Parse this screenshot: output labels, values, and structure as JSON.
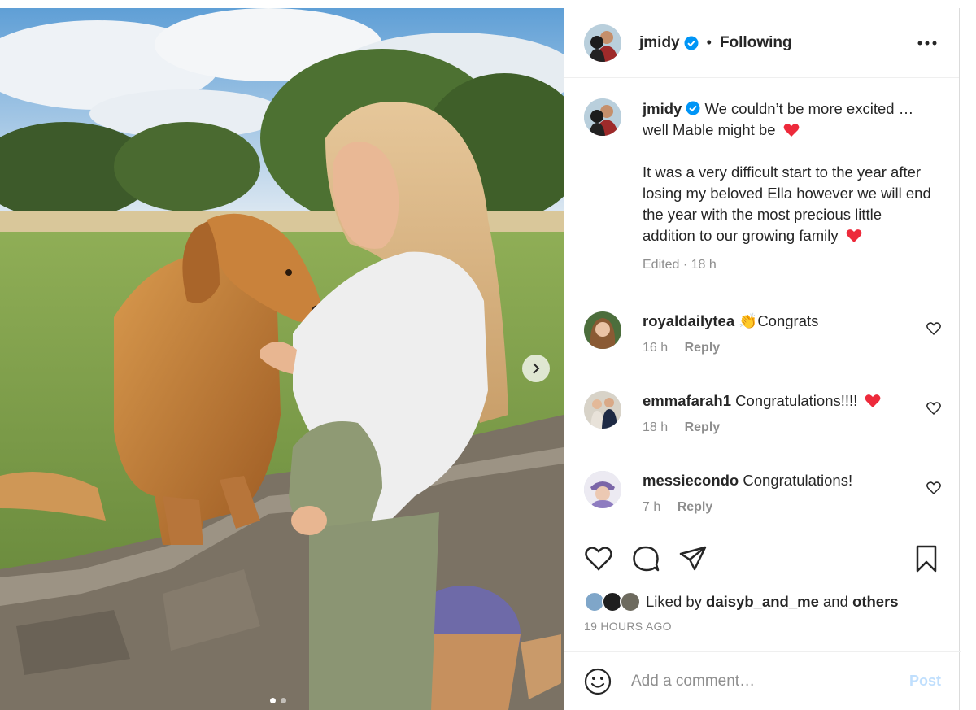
{
  "post": {
    "image_alt": "photo",
    "carousel_dot_count": 2,
    "carousel_active_index": 0
  },
  "header": {
    "username": "jmidy",
    "separator": "•",
    "follow_status": "Following",
    "more_icon": "more-options-icon"
  },
  "caption": {
    "username": "jmidy",
    "line1": "We couldn’t be more excited … well Mable might be",
    "line2": "It was a very difficult start to the year after losing my beloved Ella however we will end the year with the most precious little addition to our growing family",
    "edited": "Edited · 18 h"
  },
  "comments": [
    {
      "username": "royaldailytea",
      "emoji": "👏",
      "text": "Congrats",
      "time": "16 h",
      "reply": "Reply"
    },
    {
      "username": "emmafarah1",
      "text": "Congratulations!!!!",
      "time": "18 h",
      "reply": "Reply"
    },
    {
      "username": "messiecondo",
      "text": "Congratulations!",
      "time": "7 h",
      "reply": "Reply"
    }
  ],
  "actions": {
    "liked_prefix": "Liked by",
    "liked_user": "daisyb_and_me",
    "liked_and": "and",
    "liked_others": "others",
    "time_ago": "19 HOURS AGO"
  },
  "composer": {
    "placeholder": "Add a comment…",
    "post_label": "Post"
  },
  "colors": {
    "verified": "#0095f6",
    "heart": "#ed2a3b",
    "post_disabled": "#c0dffd",
    "muted": "#8e8e8e"
  }
}
